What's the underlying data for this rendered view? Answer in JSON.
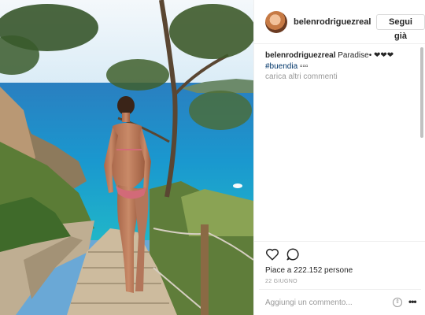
{
  "post": {
    "username": "belenrodriguezreal",
    "follow_label": "Segui già",
    "caption_text": "Paradise• ❤❤❤",
    "hashtag": "#buendia",
    "hashtag_suffix": "▫▫▫",
    "load_more": "carica altri commenti",
    "likes": "Piace a 222.152 persone",
    "date": "22 GIUGNO",
    "comment_placeholder": "Aggiungi un commento..."
  },
  "icons": {
    "like": "heart-icon",
    "comment": "comment-icon",
    "sort": "sort-icon",
    "more": "more-options-icon"
  },
  "colors": {
    "sea": "#1f8fc6",
    "sky": "#e9f3f9",
    "link": "#003569"
  }
}
